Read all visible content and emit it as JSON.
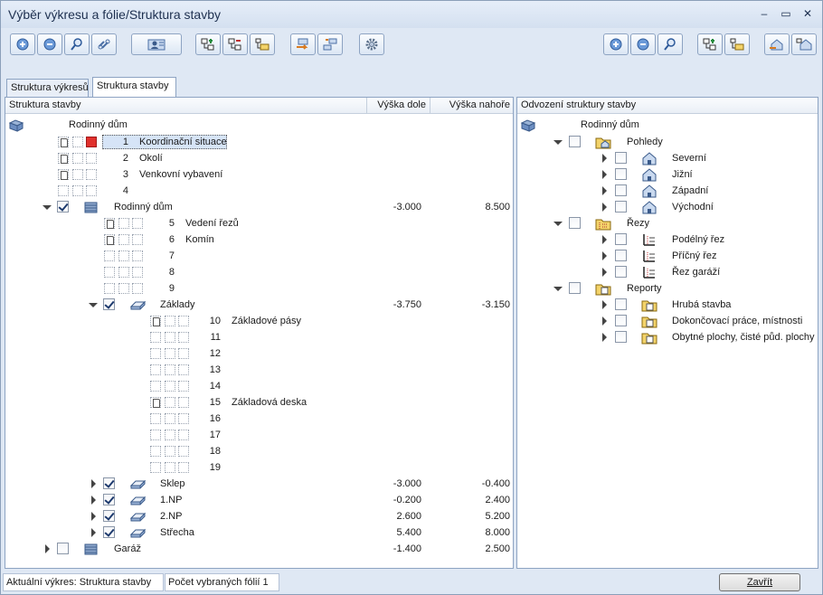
{
  "window": {
    "title": "Výběr výkresu a fólie/Struktura stavby",
    "controls": [
      "–",
      "▭",
      "✕"
    ]
  },
  "tabs": [
    {
      "label": "Struktura výkresů",
      "active": false
    },
    {
      "label": "Struktura stavby",
      "active": true
    }
  ],
  "left_panel": {
    "headers": {
      "name": "Struktura stavby",
      "low": "Výška dole",
      "high": "Výška nahoře"
    },
    "root": "Rodinný dům",
    "rows": [
      {
        "num": "1",
        "label": "Koordinační situace",
        "selected": true
      },
      {
        "num": "2",
        "label": "Okolí"
      },
      {
        "num": "3",
        "label": "Venkovní vybavení"
      },
      {
        "num": "4",
        "label": ""
      },
      {
        "label": "Rodinný dům",
        "low": "-3.000",
        "high": "8.500"
      },
      {
        "num": "5",
        "label": "Vedení řezů"
      },
      {
        "num": "6",
        "label": "Komín"
      },
      {
        "num": "7",
        "label": ""
      },
      {
        "num": "8",
        "label": ""
      },
      {
        "num": "9",
        "label": ""
      },
      {
        "label": "Základy",
        "low": "-3.750",
        "high": "-3.150"
      },
      {
        "num": "10",
        "label": "Základové pásy"
      },
      {
        "num": "11",
        "label": ""
      },
      {
        "num": "12",
        "label": ""
      },
      {
        "num": "13",
        "label": ""
      },
      {
        "num": "14",
        "label": ""
      },
      {
        "num": "15",
        "label": "Základová deska"
      },
      {
        "num": "16",
        "label": ""
      },
      {
        "num": "17",
        "label": ""
      },
      {
        "num": "18",
        "label": ""
      },
      {
        "num": "19",
        "label": ""
      },
      {
        "label": "Sklep",
        "low": "-3.000",
        "high": "-0.400"
      },
      {
        "label": "1.NP",
        "low": "-0.200",
        "high": "2.400"
      },
      {
        "label": "2.NP",
        "low": "2.600",
        "high": "5.200"
      },
      {
        "label": "Střecha",
        "low": "5.400",
        "high": "8.000"
      },
      {
        "label": "Garáž",
        "low": "-1.400",
        "high": "2.500"
      }
    ]
  },
  "right_panel": {
    "header": "Odvození struktury stavby",
    "root": "Rodinný dům",
    "groups": [
      {
        "label": "Pohledy",
        "items": [
          "Severní",
          "Jižní",
          "Západní",
          "Východní"
        ]
      },
      {
        "label": "Řezy",
        "items": [
          "Podélný řez",
          "Příčný řez",
          "Řez garáží"
        ]
      },
      {
        "label": "Reporty",
        "items": [
          "Hrubá stavba",
          "Dokončovací práce, místnosti",
          "Obytné plochy, čisté půd. plochy"
        ]
      }
    ]
  },
  "status": {
    "current_drawing": "Aktuální výkres: Struktura stavby",
    "selected_count": "Počet vybraných fólií 1",
    "close_button": "Zavřít"
  },
  "toolbar_icons": [
    "expand-plus-icon",
    "collapse-minus-icon",
    "search-icon",
    "link-icon",
    "user-card-icon",
    "structure-add-icon",
    "structure-tree-icon",
    "structure-list-icon",
    "assign-layer-icon",
    "layer-tree-icon",
    "settings-gear-icon",
    "expand-plus-icon",
    "collapse-minus-icon",
    "search-icon",
    "tree-add-icon",
    "tree-list-icon",
    "house-assign-icon",
    "house-tree-icon"
  ]
}
